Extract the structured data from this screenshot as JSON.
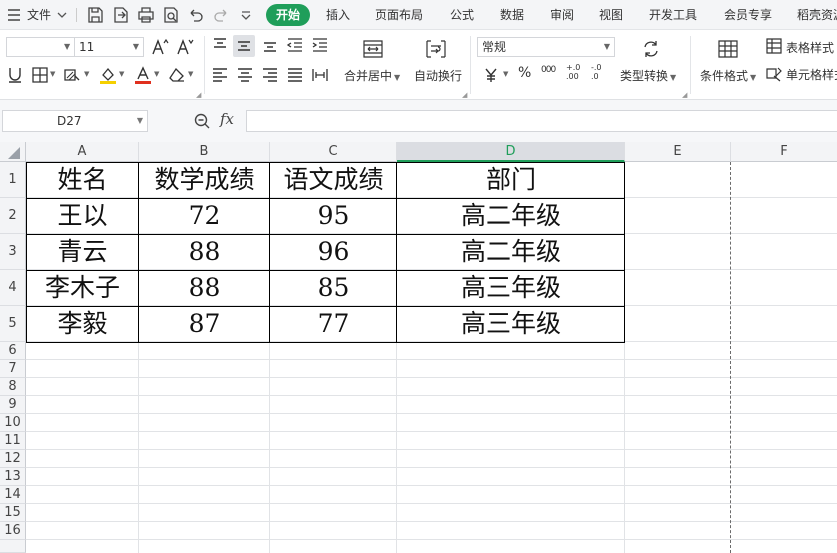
{
  "menu": {
    "file_label": "文件",
    "tabs": [
      "开始",
      "插入",
      "页面布局",
      "公式",
      "数据",
      "审阅",
      "视图",
      "开发工具",
      "会员专享",
      "稻壳资源"
    ]
  },
  "ribbon": {
    "font_name": "",
    "font_size": "11",
    "merge_label": "合并居中",
    "wrap_label": "自动换行",
    "number_format": "常规",
    "type_convert_label": "类型转换",
    "table_style_label": "表格样式",
    "cond_format_label": "条件格式",
    "cell_style_label": "单元格样式",
    "percent": "%",
    "thousands": "000",
    "dec_more": "+.0 .00",
    "dec_less": "-.0 .0"
  },
  "formula_bar": {
    "name_box": "D27",
    "fx_label": "fx",
    "content": ""
  },
  "sheet": {
    "columns": [
      "A",
      "B",
      "C",
      "D",
      "E",
      "F"
    ],
    "selected_column": "D",
    "row_numbers": [
      "1",
      "2",
      "3",
      "4",
      "5",
      "6",
      "7",
      "8",
      "9",
      "10",
      "11",
      "12",
      "13",
      "14",
      "15",
      "16"
    ],
    "table": {
      "headers": [
        "姓名",
        "数学成绩",
        "语文成绩",
        "部门"
      ],
      "rows": [
        [
          "王以",
          "72",
          "95",
          "高二年级"
        ],
        [
          "青云",
          "88",
          "96",
          "高二年级"
        ],
        [
          "李木子",
          "88",
          "85",
          "高三年级"
        ],
        [
          "李毅",
          "87",
          "77",
          "高三年级"
        ]
      ]
    }
  },
  "colors": {
    "accent": "#1f9e5a",
    "font_color": "#e0301e",
    "highlight_color": "#f5d000"
  }
}
